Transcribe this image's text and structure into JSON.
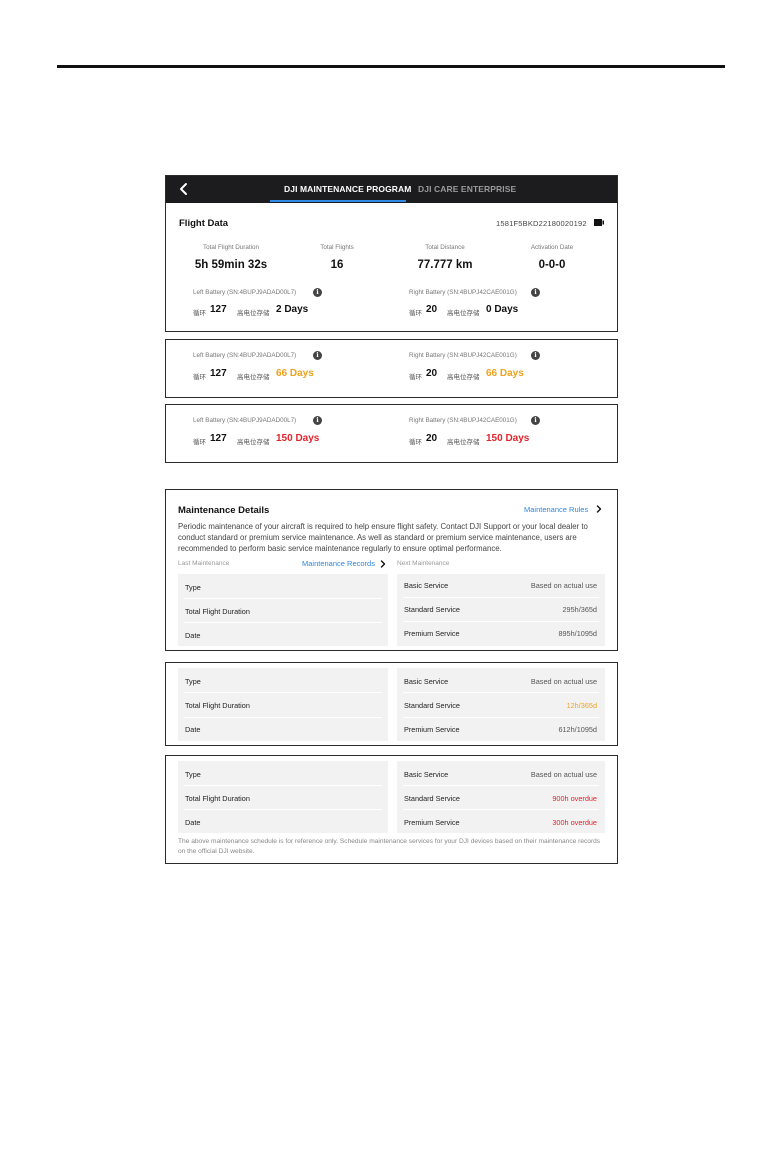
{
  "header": {
    "tab_active": "DJI MAINTENANCE PROGRAM",
    "tab_inactive": "DJI CARE ENTERPRISE"
  },
  "flight_data": {
    "title": "Flight Data",
    "serial": "1581F5BKD22180020192",
    "stats": [
      {
        "label": "Total Flight Duration",
        "value": "5h 59min 32s"
      },
      {
        "label": "Total Flights",
        "value": "16"
      },
      {
        "label": "Total Distance",
        "value": "77.777 km"
      },
      {
        "label": "Activation Date",
        "value": "0-0-0"
      }
    ]
  },
  "battery_panels": [
    {
      "left": {
        "label": "Left Battery (SN:4BUPJ9ADAD00L7)",
        "cycle_label": "循环",
        "cycles": "127",
        "storage_label": "高电位存储",
        "days": "2 Days",
        "days_color": "#111111"
      },
      "right": {
        "label": "Right Battery (SN:4BUPJ42CAE001G)",
        "cycle_label": "循环",
        "cycles": "20",
        "storage_label": "高电位存储",
        "days": "0 Days",
        "days_color": "#111111"
      }
    },
    {
      "left": {
        "label": "Left Battery (SN:4BUPJ9ADAD00L7)",
        "cycle_label": "循环",
        "cycles": "127",
        "storage_label": "高电位存储",
        "days": "66 Days",
        "days_color": "#f0a21c"
      },
      "right": {
        "label": "Right Battery (SN:4BUPJ42CAE001G)",
        "cycle_label": "循环",
        "cycles": "20",
        "storage_label": "高电位存储",
        "days": "66 Days",
        "days_color": "#f0a21c"
      }
    },
    {
      "left": {
        "label": "Left Battery (SN:4BUPJ9ADAD00L7)",
        "cycle_label": "循环",
        "cycles": "127",
        "storage_label": "高电位存储",
        "days": "150 Days",
        "days_color": "#e0242c"
      },
      "right": {
        "label": "Right Battery (SN:4BUPJ42CAE001G)",
        "cycle_label": "循环",
        "cycles": "20",
        "storage_label": "高电位存储",
        "days": "150 Days",
        "days_color": "#e0242c"
      }
    }
  ],
  "maintenance": {
    "title": "Maintenance Details",
    "rules_link": "Maintenance Rules",
    "description": "Periodic maintenance of your aircraft is required to help ensure flight safety. Contact DJI Support or your local dealer to conduct standard or premium service maintenance. As well as standard or premium service maintenance, users are recommended to perform basic service maintenance regularly to ensure optimal performance.",
    "last_label": "Last Maintenance",
    "records_link": "Maintenance Records",
    "next_label": "Next Maintenance",
    "last_rows": [
      "Type",
      "Total Flight Duration",
      "Date"
    ],
    "footnote": "The above maintenance schedule is for reference only. Schedule maintenance services for your DJI devices based on their maintenance records on the official DJI website.",
    "next_panels": [
      [
        {
          "label": "Basic Service",
          "value": "Based on actual use",
          "color": "#555555"
        },
        {
          "label": "Standard Service",
          "value": "295h/365d",
          "color": "#555555"
        },
        {
          "label": "Premium Service",
          "value": "895h/1095d",
          "color": "#555555"
        }
      ],
      [
        {
          "label": "Basic Service",
          "value": "Based on actual use",
          "color": "#555555"
        },
        {
          "label": "Standard Service",
          "value": "12h/365d",
          "color": "#f0a21c"
        },
        {
          "label": "Premium Service",
          "value": "612h/1095d",
          "color": "#555555"
        }
      ],
      [
        {
          "label": "Basic Service",
          "value": "Based on actual use",
          "color": "#555555"
        },
        {
          "label": "Standard Service",
          "value": "900h overdue",
          "color": "#e0242c"
        },
        {
          "label": "Premium Service",
          "value": "300h overdue",
          "color": "#e0242c"
        }
      ]
    ]
  },
  "icons": {
    "back": "chevron-left-icon",
    "device": "aircraft-device-icon",
    "info": "info-icon",
    "chevron": "chevron-right-icon"
  }
}
